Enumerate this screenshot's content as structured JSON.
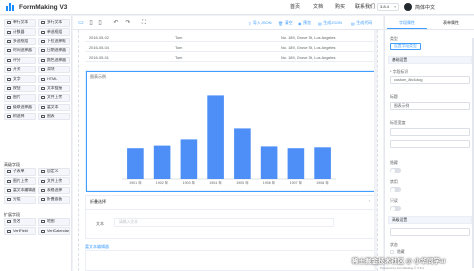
{
  "header": {
    "app_title": "FormMaking V3",
    "nav": [
      "首页",
      "文档",
      "购买",
      "联系我们"
    ],
    "version": "3.8.4",
    "language": "简体中文"
  },
  "left_panel": {
    "basic_components": [
      [
        "单行文本",
        "多行文本"
      ],
      [
        "计数器",
        "单选框组"
      ],
      [
        "多选框组",
        "下拉选择框"
      ],
      [
        "时间选择器",
        "日期选择器"
      ],
      [
        "评分",
        "颜色选择器"
      ],
      [
        "开关",
        "滑块"
      ],
      [
        "文字",
        "HTML"
      ],
      [
        "按钮",
        "文本链接"
      ],
      [
        "图片",
        "文件上传"
      ],
      [
        "级联选择器",
        "富文本"
      ],
      [
        "树选择",
        "图表"
      ]
    ],
    "advanced_title": "高级字段",
    "advanced_components": [
      [
        "子表单",
        "自定义"
      ],
      [
        "图片上传",
        "文件上传"
      ],
      [
        "富文本编辑器",
        "表格选择"
      ],
      [
        "分组",
        "折叠面板"
      ]
    ],
    "extension_title": "扩展字段",
    "extension_components": [
      [
        "签名",
        "地图"
      ],
      [
        "VeriField",
        "VeriCalendar"
      ]
    ]
  },
  "toolbar": {
    "icons": [
      "pc-icon",
      "tablet-icon",
      "phone-icon",
      "undo-icon",
      "redo-icon",
      "fullscreen-icon"
    ],
    "actions": [
      "导入JSON",
      "清空",
      "预览",
      "生成JSON",
      "生成代码"
    ]
  },
  "canvas": {
    "table_rows": [
      {
        "date": "2016-05-02",
        "name": "Tom",
        "address": "No. 189, Grove St, Los Angeles"
      },
      {
        "date": "2016-05-04",
        "name": "Tom",
        "address": "No. 189, Grove St, Los Angeles"
      },
      {
        "date": "2016-05-01",
        "name": "Tom",
        "address": "No. 189, Grove St, Los Angeles"
      }
    ],
    "chart_title": "图表示例",
    "fold_title": "折叠选择",
    "fold_label": "文本",
    "fold_placeholder": "请输入文本",
    "rich_title": "富文本编辑器"
  },
  "chart_data": {
    "type": "bar",
    "categories": [
      "1901 年",
      "1902 年",
      "1903 年",
      "1904 年",
      "1905 年",
      "1906 年",
      "1907 年",
      "1908 年"
    ],
    "values": [
      700,
      760,
      900,
      1900,
      1150,
      740,
      700,
      720
    ],
    "ylim": [
      0,
      2000
    ],
    "title": "图表示例",
    "xlabel": "",
    "ylabel": "",
    "bar_color": "#4e8ef7"
  },
  "right_panel": {
    "tabs": [
      "字段属性",
      "表单属性"
    ],
    "type_label": "类型",
    "type_button": "设置字段类型",
    "basic_section": "基础设置",
    "field_id_label": "* 字段标识",
    "field_id_value": "custom_8iv4oiog",
    "title_label": "标题",
    "title_value": "图表示例",
    "width_label": "标签宽度",
    "hide_label_text": "标签隐藏",
    "switch_labels": [
      "隐藏",
      "禁用",
      "只读"
    ],
    "advanced_section": "高级设置",
    "state_label": "状态",
    "state_option": "隐藏"
  },
  "watermark": "稀土掘金技术社区 @ 小华同学ai",
  "powered": "Powered by FormMaking © 3.8.4",
  "colors": {
    "accent": "#409eff",
    "chart_bar": "#4e8ef7"
  }
}
